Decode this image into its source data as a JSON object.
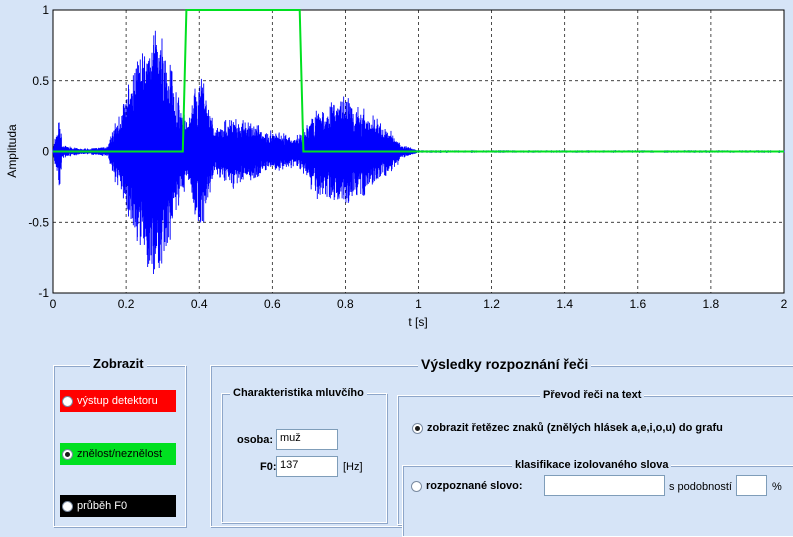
{
  "chart_data": {
    "type": "line",
    "xlabel": "t [s]",
    "ylabel": "Amplituda",
    "xlim": [
      0,
      2
    ],
    "ylim": [
      -1,
      1
    ],
    "x_ticks": [
      "0",
      "0.2",
      "0.4",
      "0.6",
      "0.8",
      "1",
      "1.2",
      "1.4",
      "1.6",
      "1.8",
      "2"
    ],
    "y_ticks": [
      "1",
      "0.5",
      "0",
      "-0.5",
      "-1"
    ],
    "grid": true,
    "series": [
      {
        "kind": "waveform",
        "color": "#0000ff",
        "envelope": [
          {
            "x": 0.0,
            "amp": 0.02
          },
          {
            "x": 0.018,
            "amp": 0.3
          },
          {
            "x": 0.025,
            "amp": 0.05
          },
          {
            "x": 0.08,
            "amp": 0.02
          },
          {
            "x": 0.15,
            "amp": 0.04
          },
          {
            "x": 0.16,
            "amp": 0.15
          },
          {
            "x": 0.2,
            "amp": 0.45
          },
          {
            "x": 0.25,
            "amp": 0.88
          },
          {
            "x": 0.28,
            "amp": 0.98
          },
          {
            "x": 0.31,
            "amp": 0.8
          },
          {
            "x": 0.34,
            "amp": 0.45
          },
          {
            "x": 0.37,
            "amp": 0.22
          },
          {
            "x": 0.39,
            "amp": 0.5
          },
          {
            "x": 0.41,
            "amp": 0.62
          },
          {
            "x": 0.44,
            "amp": 0.18
          },
          {
            "x": 0.5,
            "amp": 0.28
          },
          {
            "x": 0.6,
            "amp": 0.15
          },
          {
            "x": 0.67,
            "amp": 0.12
          },
          {
            "x": 0.69,
            "amp": 0.2
          },
          {
            "x": 0.72,
            "amp": 0.35
          },
          {
            "x": 0.8,
            "amp": 0.42
          },
          {
            "x": 0.88,
            "amp": 0.28
          },
          {
            "x": 0.96,
            "amp": 0.05
          },
          {
            "x": 1.0,
            "amp": 0.01
          },
          {
            "x": 2.0,
            "amp": 0.01
          }
        ]
      },
      {
        "kind": "step",
        "color": "#00e020",
        "x": [
          0,
          0.355,
          0.365,
          0.675,
          0.685,
          2.0
        ],
        "y": [
          0,
          0,
          1,
          1,
          0,
          0
        ]
      }
    ]
  },
  "display_panel": {
    "title": "Zobrazit",
    "options": [
      {
        "label": "výstup detektoru",
        "color": "#ff0000",
        "text_color": "#ffffff",
        "checked": false
      },
      {
        "label": "znělost/neznělost",
        "color": "#00e020",
        "text_color": "#000000",
        "checked": true
      },
      {
        "label": "průběh F0",
        "color": "#000000",
        "text_color": "#ffffff",
        "checked": false
      }
    ]
  },
  "results_panel": {
    "title": "Výsledky rozpoznání řeči",
    "speaker": {
      "title": "Charakteristika mluvčího",
      "person_label": "osoba:",
      "person_value": "muž",
      "f0_label": "F0:",
      "f0_value": "137",
      "f0_unit": "[Hz]"
    },
    "conversion": {
      "title": "Převod řeči na text",
      "show_string_label": "zobrazit řetězec znaků  (znělých hlásek a,e,i,o,u) do grafu",
      "show_string_checked": true,
      "classification": {
        "title": "klasifikace izolovaného slova",
        "recognized_label": "rozpoznané slovo:",
        "recognized_checked": false,
        "recognized_value": "",
        "similarity_label": "s podobností",
        "similarity_value": "",
        "percent": "%"
      }
    }
  }
}
